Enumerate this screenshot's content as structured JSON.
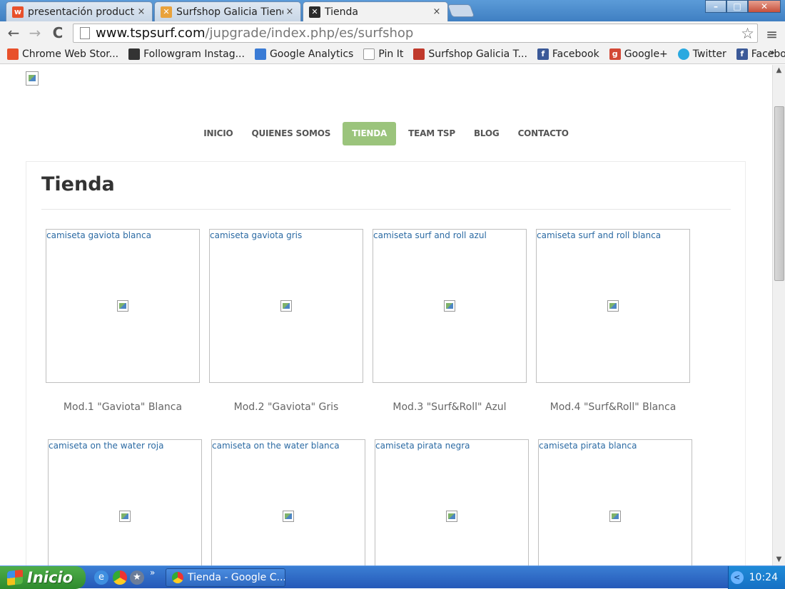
{
  "tabs": [
    {
      "title": "presentación productos",
      "favicon_letter": "w",
      "favicon_color": "#e8502a",
      "close": "×"
    },
    {
      "title": "Surfshop Galicia Tienda",
      "favicon_letter": "✕",
      "favicon_color": "#e9a23b",
      "close": "×"
    },
    {
      "title": "Tienda",
      "favicon_letter": "✕",
      "favicon_color": "#2a2a2a",
      "close": "×"
    }
  ],
  "window_buttons": {
    "minimize": "–",
    "maximize": "□",
    "close": "✕"
  },
  "toolbar": {
    "back": "←",
    "forward": "→",
    "reload": "C",
    "url_host": "www.tspsurf.com",
    "url_path": "/jupgrade/index.php/es/surfshop",
    "star": "☆",
    "menu": "≡"
  },
  "bookmarks": [
    {
      "label": "Chrome Web Stor...",
      "icon": "chrome-store-icon",
      "color": "#e8502a"
    },
    {
      "label": "Followgram Instag...",
      "icon": "followgram-icon",
      "color": "#333333"
    },
    {
      "label": "Google Analytics",
      "icon": "google-analytics-icon",
      "color": "#3a7bd5"
    },
    {
      "label": "Pin It",
      "icon": "page-icon",
      "color": "#ffffff"
    },
    {
      "label": "Surfshop Galicia T...",
      "icon": "surfshop-icon",
      "color": "#c0392b"
    },
    {
      "label": "Facebook",
      "icon": "facebook-icon",
      "color": "#3b5998"
    },
    {
      "label": "Google+",
      "icon": "google-plus-icon",
      "color": "#d34836"
    },
    {
      "label": "Twitter",
      "icon": "twitter-icon",
      "color": "#2aa9e0"
    },
    {
      "label": "Facebook",
      "icon": "facebook-icon",
      "color": "#3b5998"
    }
  ],
  "bookmarks_more": "»",
  "site": {
    "nav": [
      {
        "label": "INICIO",
        "active": false
      },
      {
        "label": "QUIENES SOMOS",
        "active": false
      },
      {
        "label": "TIENDA",
        "active": true
      },
      {
        "label": "TEAM TSP",
        "active": false
      },
      {
        "label": "BLOG",
        "active": false
      },
      {
        "label": "CONTACTO",
        "active": false
      }
    ],
    "nav_active_color": "#9bc47c",
    "page_title": "Tienda",
    "products": [
      {
        "alt": "camiseta gaviota blanca",
        "caption": "Mod.1 \"Gaviota\" Blanca"
      },
      {
        "alt": "camiseta gaviota gris",
        "caption": "Mod.2 \"Gaviota\" Gris"
      },
      {
        "alt": "camiseta surf and roll azul",
        "caption": "Mod.3 \"Surf&Roll\" Azul"
      },
      {
        "alt": "camiseta surf and roll blanca",
        "caption": "Mod.4 \"Surf&Roll\" Blanca"
      },
      {
        "alt": "camiseta on the water roja",
        "caption": ""
      },
      {
        "alt": "camiseta on the water blanca",
        "caption": ""
      },
      {
        "alt": "camiseta pirata negra",
        "caption": ""
      },
      {
        "alt": "camiseta pirata blanca",
        "caption": ""
      }
    ]
  },
  "taskbar": {
    "start_label": "Inicio",
    "quicklaunch_more": "»",
    "task_label": "Tienda - Google C...",
    "clock": "10:24",
    "tray_arrow": "<"
  }
}
